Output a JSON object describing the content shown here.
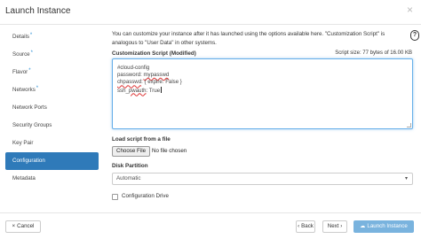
{
  "dialog": {
    "title": "Launch Instance",
    "close_glyph": "×"
  },
  "sidebar": {
    "items": [
      {
        "label": "Details",
        "required": true
      },
      {
        "label": "Source",
        "required": true
      },
      {
        "label": "Flavor",
        "required": true
      },
      {
        "label": "Networks",
        "required": true
      },
      {
        "label": "Network Ports",
        "required": false
      },
      {
        "label": "Security Groups",
        "required": false
      },
      {
        "label": "Key Pair",
        "required": false
      },
      {
        "label": "Configuration",
        "required": false,
        "active": true
      },
      {
        "label": "Metadata",
        "required": false
      }
    ],
    "required_mark": "*"
  },
  "config": {
    "description": "You can customize your instance after it has launched using the options available here. \"Customization Script\" is analogous to \"User Data\" in other systems.",
    "help_glyph": "?",
    "script_label": "Customization Script (Modified)",
    "script_size": "Script size: 77 bytes of 16.00 KB",
    "script_lines": {
      "l1": "#cloud-config",
      "l2_key": "password: ",
      "l2_val": "mypasswd",
      "l3_key": "chpasswd",
      "l3_rest": ": { expire: False }",
      "l4_key": "ssh_",
      "l4_mid": "pwauth",
      "l4_rest": ": True"
    },
    "load_label": "Load script from a file",
    "file_button": "Choose File",
    "file_status": "No file chosen",
    "partition_label": "Disk Partition",
    "partition_value": "Automatic",
    "config_drive_label": "Configuration Drive",
    "config_drive_checked": false
  },
  "footer": {
    "cancel": "Cancel",
    "back": "Back",
    "next": "Next",
    "launch": "Launch Instance",
    "cancel_icon": "×",
    "back_icon": "‹",
    "next_icon": "›",
    "launch_icon": "☁"
  },
  "colors": {
    "active_nav": "#2f7ab9",
    "required_star": "#2a8fd6",
    "launch_button": "#79b3de",
    "focus_border": "#66afe9"
  }
}
